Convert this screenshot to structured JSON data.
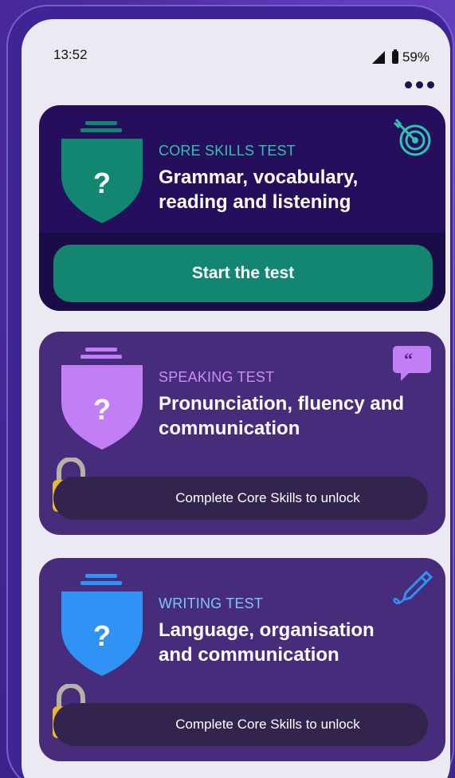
{
  "status_bar": {
    "time": "13:52",
    "battery": "59%"
  },
  "cards": [
    {
      "label": "CORE SKILLS TEST",
      "title": "Grammar, vocabulary, reading and listening",
      "action": "Start the test",
      "icon": "target-icon",
      "accent": "#2ec4b0",
      "shield_color": "#138672"
    },
    {
      "label": "SPEAKING TEST",
      "title": "Pronunciation, fluency and communication",
      "action": "Complete Core Skills to unlock",
      "icon": "speech-bubble-icon",
      "accent": "#c98ff7",
      "shield_color": "#c27ef5"
    },
    {
      "label": "WRITING TEST",
      "title": "Language, organisation and communication",
      "action": "Complete Core Skills to unlock",
      "icon": "pen-icon",
      "accent": "#7cc4ff",
      "shield_color": "#2f93f5"
    }
  ]
}
